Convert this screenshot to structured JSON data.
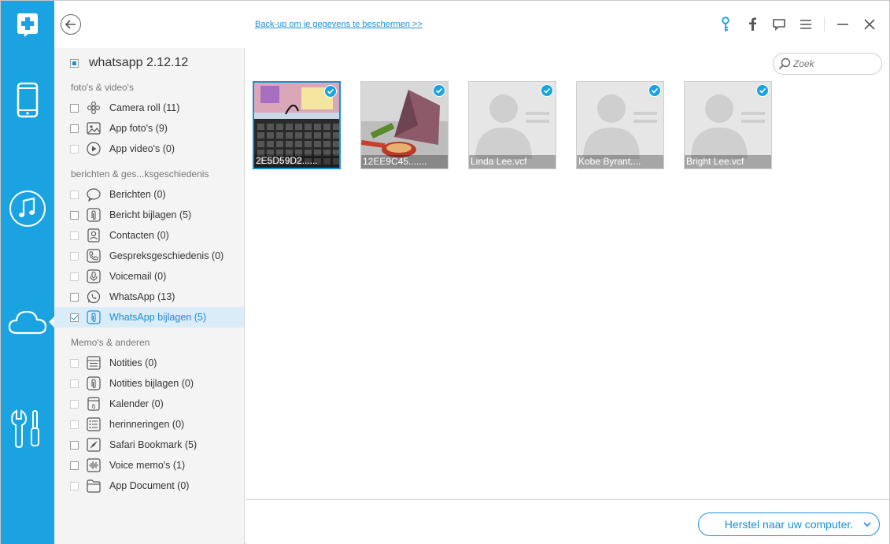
{
  "header": {
    "backup_link": "Back-up om je gegevens te beschermen >>"
  },
  "rail": {
    "items": [
      "device",
      "music",
      "icloud",
      "tools"
    ]
  },
  "device": {
    "name": "whatsapp 2.12.12"
  },
  "sections": [
    {
      "title": "foto's & video's",
      "items": [
        {
          "label": "Camera roll (11)",
          "icon": "flower-icon",
          "checked": false,
          "enabled": true
        },
        {
          "label": "App foto's (9)",
          "icon": "image-icon",
          "checked": false,
          "enabled": true
        },
        {
          "label": "App video's (0)",
          "icon": "play-icon",
          "checked": false,
          "enabled": false
        }
      ]
    },
    {
      "title": "berichten & ges...ksgeschiedenis",
      "items": [
        {
          "label": "Berichten (0)",
          "icon": "chat-bubble-icon",
          "checked": false,
          "enabled": false
        },
        {
          "label": "Bericht bijlagen (5)",
          "icon": "paperclip-icon",
          "checked": false,
          "enabled": true
        },
        {
          "label": "Contacten (0)",
          "icon": "contact-icon",
          "checked": false,
          "enabled": false
        },
        {
          "label": "Gespreksgeschiedenis (0)",
          "icon": "phone-icon",
          "checked": false,
          "enabled": false
        },
        {
          "label": "Voicemail (0)",
          "icon": "microphone-icon",
          "checked": false,
          "enabled": false
        },
        {
          "label": "WhatsApp (13)",
          "icon": "whatsapp-icon",
          "checked": false,
          "enabled": true
        },
        {
          "label": "WhatsApp bijlagen (5)",
          "icon": "paperclip-icon",
          "checked": true,
          "enabled": true,
          "selected": true
        }
      ]
    },
    {
      "title": "Memo's & anderen",
      "items": [
        {
          "label": "Notities (0)",
          "icon": "notes-icon",
          "checked": false,
          "enabled": false
        },
        {
          "label": "Notities bijlagen (0)",
          "icon": "paperclip-icon",
          "checked": false,
          "enabled": false
        },
        {
          "label": "Kalender (0)",
          "icon": "calendar-icon",
          "checked": false,
          "enabled": false
        },
        {
          "label": "herinneringen (0)",
          "icon": "list-icon",
          "checked": false,
          "enabled": false
        },
        {
          "label": "Safari Bookmark (5)",
          "icon": "compass-icon",
          "checked": false,
          "enabled": true
        },
        {
          "label": "Voice memo's (1)",
          "icon": "waveform-icon",
          "checked": false,
          "enabled": true
        },
        {
          "label": "App Document (0)",
          "icon": "folder-icon",
          "checked": false,
          "enabled": false
        }
      ]
    }
  ],
  "search": {
    "placeholder": "Zoek"
  },
  "files": [
    {
      "name": "2E5D59D2......",
      "kind": "photo-keyboard",
      "checked": true,
      "selected": true
    },
    {
      "name": "12EE9C45.......",
      "kind": "photo-food",
      "checked": true,
      "selected": false
    },
    {
      "name": "Linda Lee.vcf",
      "kind": "contact",
      "checked": true,
      "selected": false
    },
    {
      "name": "Kobe Byrant....",
      "kind": "contact",
      "checked": true,
      "selected": false
    },
    {
      "name": "Bright Lee.vcf",
      "kind": "contact",
      "checked": true,
      "selected": false
    }
  ],
  "footer": {
    "restore_label": "Herstel naar uw computer."
  },
  "colors": {
    "accent": "#1aa3e0",
    "link": "#1a8fd6",
    "panel": "#f4f4f4"
  }
}
